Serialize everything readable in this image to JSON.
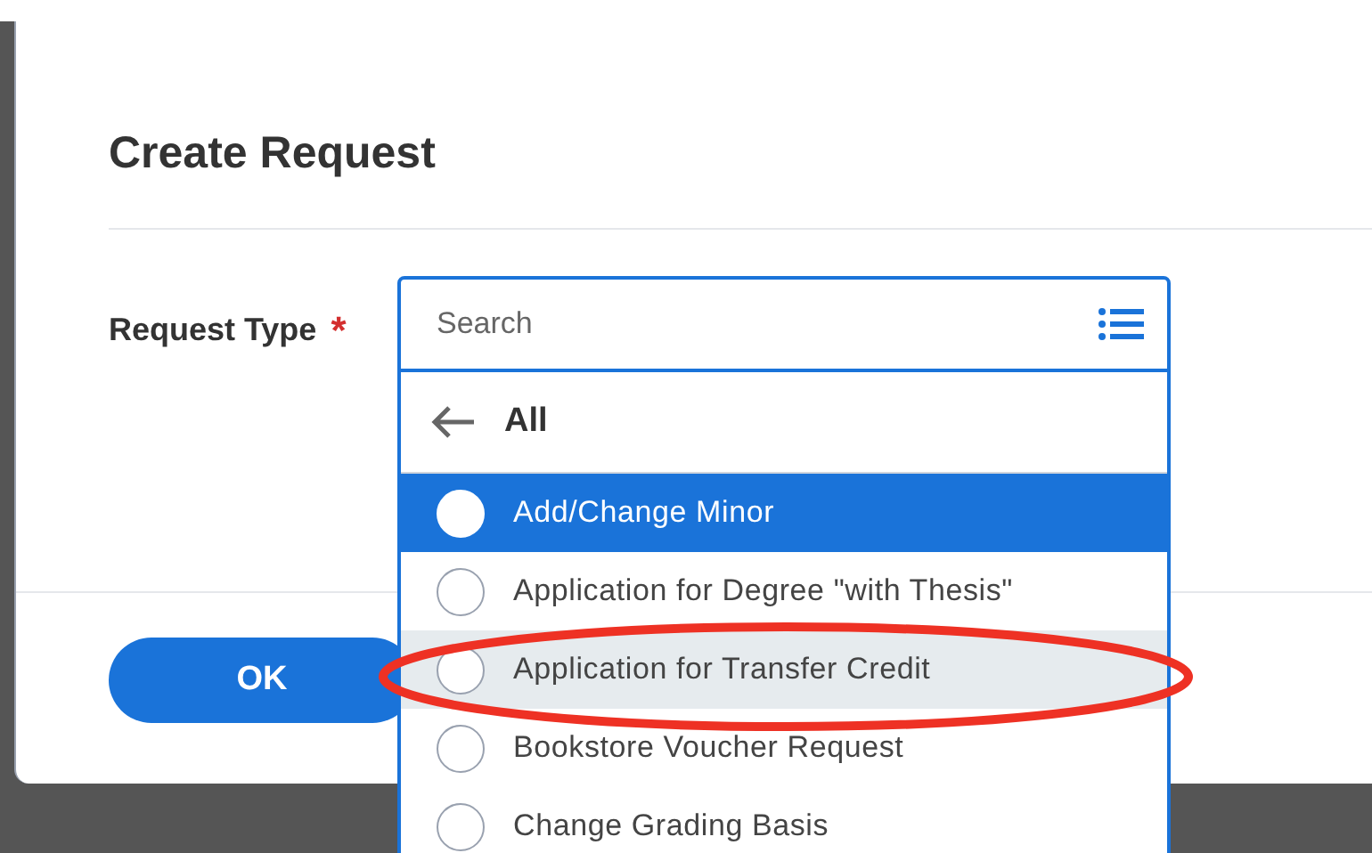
{
  "dialog": {
    "title": "Create Request",
    "field": {
      "label": "Request Type",
      "required_mark": "*",
      "placeholder": "Search"
    },
    "ok_button": "OK"
  },
  "dropdown": {
    "back": "All",
    "items": [
      {
        "label": "Add/Change Minor",
        "selected": true,
        "hovered": false
      },
      {
        "label": "Application for Degree \"with Thesis\"",
        "selected": false,
        "hovered": false
      },
      {
        "label": "Application for Transfer Credit",
        "selected": false,
        "hovered": true
      },
      {
        "label": "Bookstore Voucher Request",
        "selected": false,
        "hovered": false
      },
      {
        "label": "Change Grading Basis",
        "selected": false,
        "hovered": false
      }
    ]
  }
}
